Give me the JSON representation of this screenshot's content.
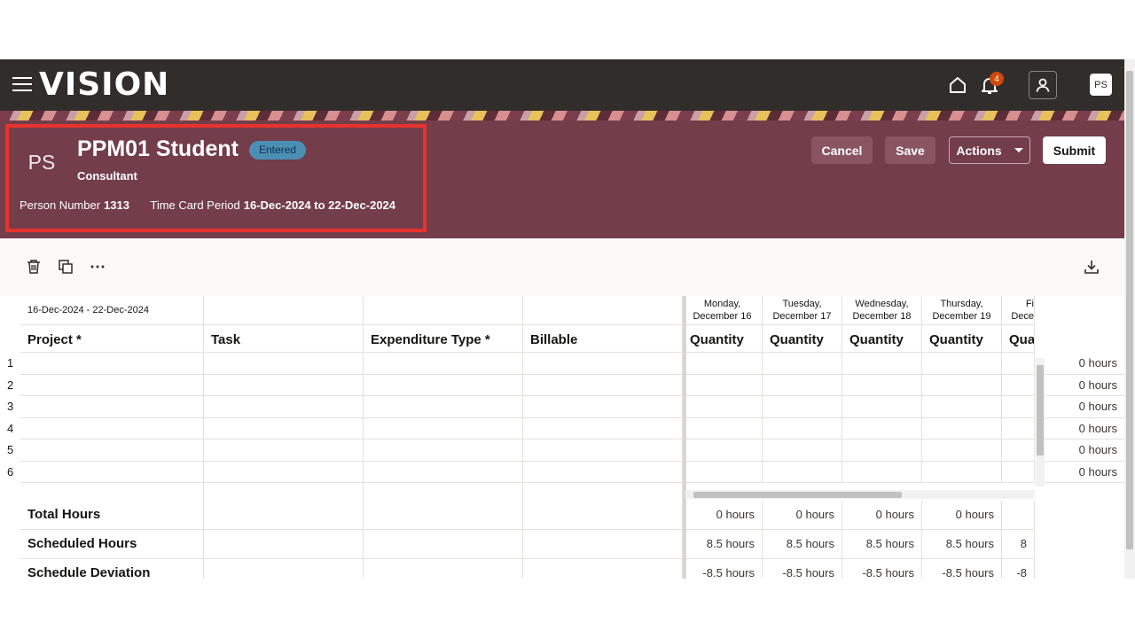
{
  "topbar": {
    "logo": "VISION",
    "notification_count": "4",
    "avatar_initials": "PS"
  },
  "header": {
    "avatar_initials": "PS",
    "name": "PPM01 Student",
    "status": "Entered",
    "job_title": "Consultant",
    "person_number_label": "Person Number",
    "person_number": "1313",
    "period_label": "Time Card Period",
    "period": "16-Dec-2024 to 22-Dec-2024",
    "buttons": {
      "cancel": "Cancel",
      "save": "Save",
      "actions": "Actions",
      "submit": "Submit"
    }
  },
  "colors": {
    "topbar_bg": "#312d2a",
    "header_bg": "#733d4a",
    "highlight_border": "#e8322c",
    "badge_bg": "#4b8fb5",
    "notification_badge": "#d1480a"
  },
  "toolbar": {
    "icons": [
      "delete-icon",
      "duplicate-icon",
      "more-icon",
      "download-icon"
    ],
    "more_glyph": "⋯"
  },
  "grid": {
    "date_range": "16-Dec-2024 - 22-Dec-2024",
    "columns": [
      "Project *",
      "Task",
      "Expenditure Type *",
      "Billable"
    ],
    "days": [
      {
        "line1": "Monday,",
        "line2": "December 16",
        "col": "Quantity"
      },
      {
        "line1": "Tuesday,",
        "line2": "December 17",
        "col": "Quantity"
      },
      {
        "line1": "Wednesday,",
        "line2": "December 18",
        "col": "Quantity"
      },
      {
        "line1": "Thursday,",
        "line2": "December 19",
        "col": "Quantity"
      },
      {
        "line1": "Fi",
        "line2": "Dece",
        "col": "Qua"
      }
    ],
    "rows": [
      {
        "num": "1",
        "total": "0 hours"
      },
      {
        "num": "2",
        "total": "0 hours"
      },
      {
        "num": "3",
        "total": "0 hours"
      },
      {
        "num": "4",
        "total": "0 hours"
      },
      {
        "num": "5",
        "total": "0 hours"
      },
      {
        "num": "6",
        "total": "0 hours"
      }
    ],
    "summary": [
      {
        "label": "Total Hours",
        "values": [
          "0 hours",
          "0 hours",
          "0 hours",
          "0 hours",
          ""
        ]
      },
      {
        "label": "Scheduled Hours",
        "values": [
          "8.5 hours",
          "8.5 hours",
          "8.5 hours",
          "8.5 hours",
          "8"
        ]
      },
      {
        "label": "Schedule Deviation",
        "values": [
          "-8.5 hours",
          "-8.5 hours",
          "-8.5 hours",
          "-8.5 hours",
          "-8"
        ]
      }
    ]
  }
}
